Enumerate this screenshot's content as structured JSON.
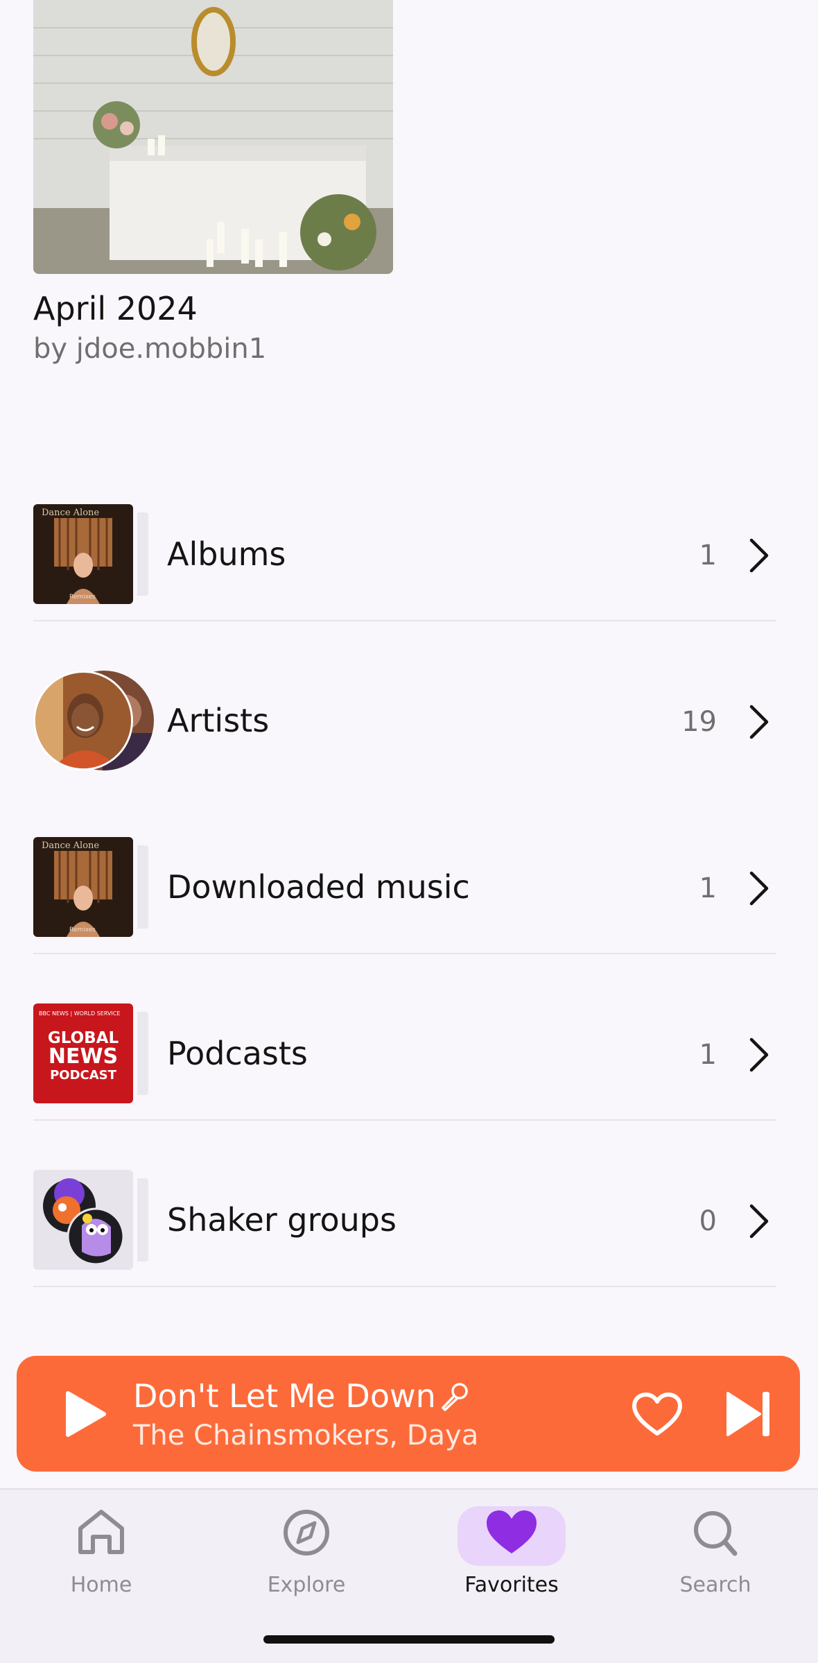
{
  "playlist": {
    "title": "April 2024",
    "subtitle": "by jdoe.mobbin1",
    "cover_icon": "wedding-table-photo"
  },
  "library": {
    "rows": [
      {
        "label": "Albums",
        "count": "1",
        "icon": "album-cover"
      },
      {
        "label": "Artists",
        "count": "19",
        "icon": "artist-avatar"
      },
      {
        "label": "Downloaded music",
        "count": "1",
        "icon": "album-cover"
      },
      {
        "label": "Podcasts",
        "count": "1",
        "icon": "podcast-cover"
      },
      {
        "label": "Shaker groups",
        "count": "0",
        "icon": "group-avatars"
      }
    ]
  },
  "podcast_cover": {
    "top": "BBC NEWS | WORLD SERVICE",
    "line1": "GLOBAL",
    "line2": "NEWS",
    "line3": "PODCAST"
  },
  "now_playing": {
    "song": "Don't Let Me Down",
    "artist": "The Chainsmokers, Daya",
    "accent": "#fd6a3a"
  },
  "tabbar": {
    "tabs": [
      {
        "label": "Home",
        "icon": "home-icon"
      },
      {
        "label": "Explore",
        "icon": "compass-icon"
      },
      {
        "label": "Favorites",
        "icon": "heart-icon",
        "active": true
      },
      {
        "label": "Search",
        "icon": "search-icon"
      }
    ],
    "active_color": "#8e2de2"
  }
}
